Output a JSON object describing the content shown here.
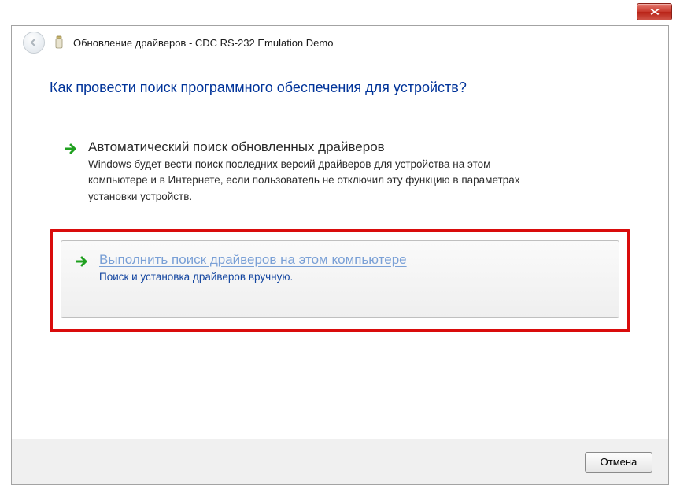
{
  "window": {
    "title": "Обновление драйверов - CDC RS-232 Emulation Demo"
  },
  "main": {
    "question": "Как провести поиск программного обеспечения для устройств?",
    "options": {
      "auto": {
        "title": "Автоматический поиск обновленных драйверов",
        "desc": "Windows будет вести поиск последних версий драйверов для устройства на этом компьютере и в Интернете, если пользователь не отключил эту функцию в параметрах установки устройств."
      },
      "manual": {
        "title": "Выполнить поиск драйверов на этом компьютере",
        "desc": "Поиск и установка драйверов вручную."
      }
    }
  },
  "footer": {
    "cancel": "Отмена"
  }
}
